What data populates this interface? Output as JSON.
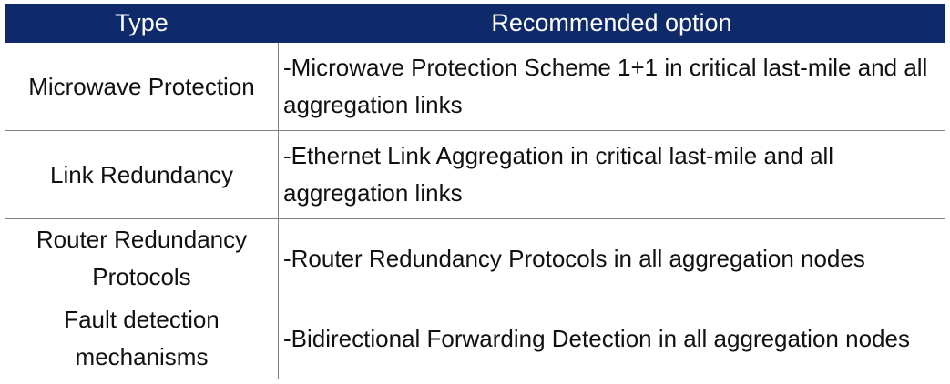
{
  "table": {
    "headers": [
      "Type",
      "Recommended option"
    ],
    "rows": [
      {
        "type": "Microwave Protection",
        "option": "-Microwave Protection Scheme 1+1 in critical last-mile and all aggregation links"
      },
      {
        "type": "Link Redundancy",
        "option": "-Ethernet Link Aggregation in critical last-mile and all aggregation links"
      },
      {
        "type": "Router Redundancy Protocols",
        "option": "-Router Redundancy Protocols in all aggregation nodes"
      },
      {
        "type": "Fault detection mechanisms",
        "option": "-Bidirectional Forwarding Detection in all aggregation nodes"
      }
    ]
  },
  "colors": {
    "header_background": "#0f2a6b",
    "header_text": "#ffffff",
    "border": "#7f7f7f"
  }
}
